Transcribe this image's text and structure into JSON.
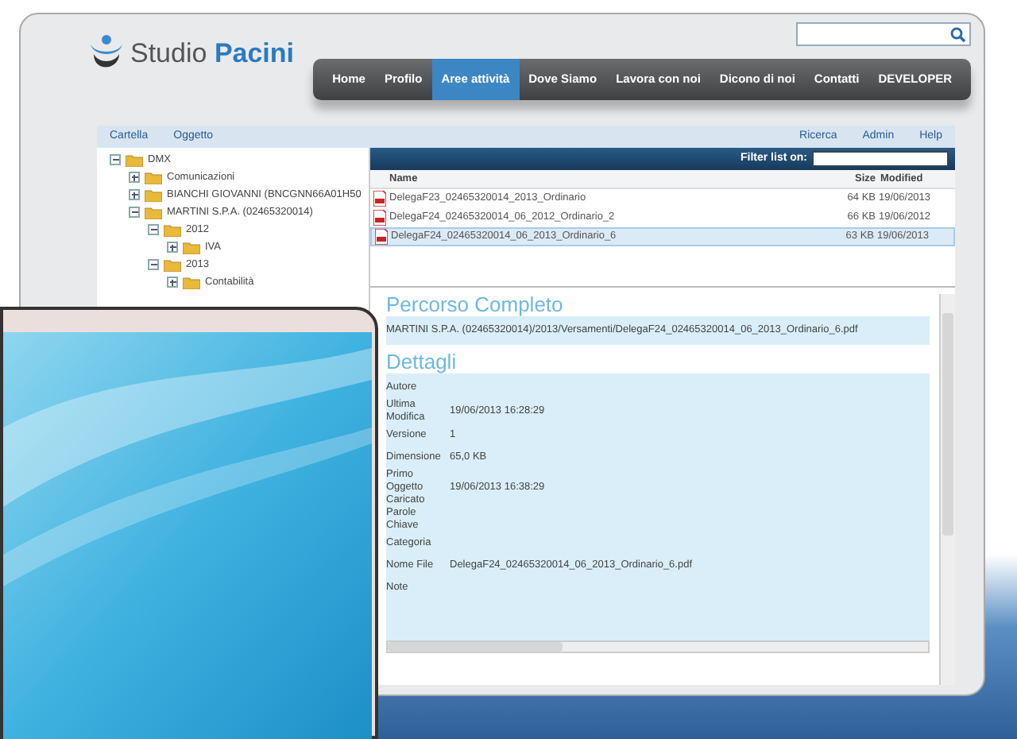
{
  "logo": {
    "text": "Studio",
    "accent": "Pacini"
  },
  "nav": [
    {
      "label": "Home",
      "selected": false
    },
    {
      "label": "Profilo",
      "selected": false
    },
    {
      "label": "Aree attività",
      "selected": true
    },
    {
      "label": "Dove Siamo",
      "selected": false
    },
    {
      "label": "Lavora con noi",
      "selected": false
    },
    {
      "label": "Dicono di noi",
      "selected": false
    },
    {
      "label": "Contatti",
      "selected": false
    },
    {
      "label": "DEVELOPER",
      "selected": false
    }
  ],
  "toolbar": {
    "left": [
      "Cartella",
      "Oggetto"
    ],
    "right": [
      "Ricerca",
      "Admin",
      "Help"
    ]
  },
  "tree": [
    {
      "label": "DMX",
      "expanded": true,
      "children": [
        {
          "label": "Comunicazioni",
          "expanded": false
        },
        {
          "label": "BIANCHI GIOVANNI (BNCGNN66A01H50",
          "expanded": false
        },
        {
          "label": "MARTINI S.P.A. (02465320014)",
          "expanded": true,
          "children": [
            {
              "label": "2012",
              "expanded": true,
              "children": [
                {
                  "label": "IVA",
                  "expanded": false
                }
              ]
            },
            {
              "label": "2013",
              "expanded": true,
              "children": [
                {
                  "label": "Contabilità",
                  "expanded": false
                }
              ]
            }
          ]
        }
      ]
    }
  ],
  "file_list": {
    "filter_label": "Filter list on:",
    "columns": [
      "Name",
      "Size",
      "Modified"
    ],
    "rows": [
      {
        "name": "DelegaF23_02465320014_2013_Ordinario",
        "size": "64 KB",
        "modified": "19/06/2013",
        "selected": false
      },
      {
        "name": "DelegaF24_02465320014_06_2012_Ordinario_2",
        "size": "66 KB",
        "modified": "19/06/2012",
        "selected": false
      },
      {
        "name": "DelegaF24_02465320014_06_2013_Ordinario_6",
        "size": "63 KB",
        "modified": "19/06/2013",
        "selected": true
      }
    ]
  },
  "path_section": {
    "title": "Percorso Completo",
    "value": "MARTINI S.P.A. (02465320014)/2013/Versamenti/DelegaF24_02465320014_06_2013_Ordinario_6.pdf"
  },
  "details_section": {
    "title": "Dettagli",
    "fields": [
      {
        "label": "Autore"
      },
      {
        "label": "Ultima Modifica",
        "value": "19/06/2013 16:28:29"
      },
      {
        "label": "Versione",
        "value": "1"
      },
      {
        "label": "Dimensione",
        "value": "65,0 KB"
      },
      {
        "label": "Primo Oggetto Caricato",
        "value": "19/06/2013 16:38:29"
      },
      {
        "label": "Parole Chiave"
      },
      {
        "label": "Categoria"
      },
      {
        "label": "Nome File",
        "value": "DelegaF24_02465320014_06_2013_Ordinario_6.pdf"
      },
      {
        "label": "Note"
      }
    ]
  }
}
